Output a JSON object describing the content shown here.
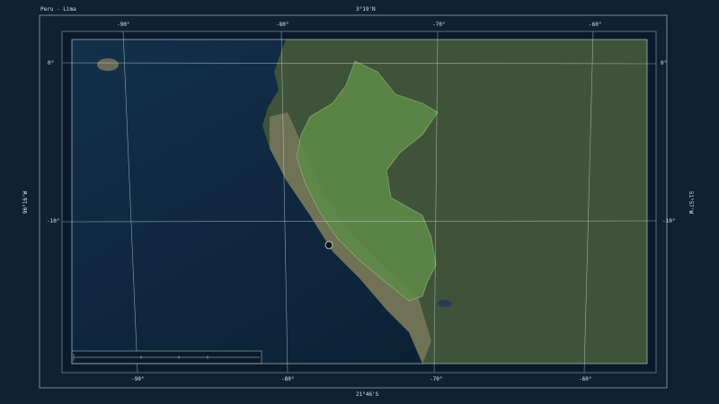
{
  "title": "Peru - Lima",
  "extent": {
    "north": "3°19'N",
    "south": "21°46'S",
    "west": "96°16'W",
    "east": "51°57'W"
  },
  "longitude_labels": [
    "-90°",
    "-80°",
    "-70°",
    "-60°"
  ],
  "latitude_labels": [
    "0°",
    "-10°"
  ],
  "capital": "Lima",
  "colors": {
    "background": "#0f2233",
    "ocean": "#0c2238",
    "land": "#3d5236",
    "highlight": "#5f8a4a",
    "grid": "#c8d4dc"
  }
}
